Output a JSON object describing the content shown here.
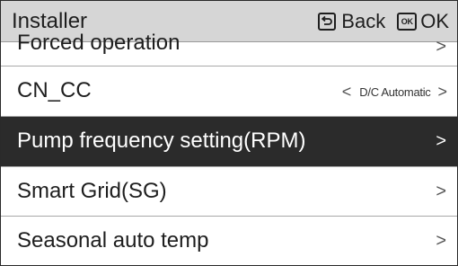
{
  "header": {
    "title": "Installer",
    "back_label": "Back",
    "ok_label": "OK",
    "ok_icon_text": "OK"
  },
  "menu": {
    "items": [
      {
        "label": "Forced operation",
        "chevron": ">"
      },
      {
        "label": "CN_CC",
        "value": "D/C Automatic",
        "left_arrow": "<",
        "right_arrow": ">"
      },
      {
        "label": "Pump frequency setting(RPM)",
        "chevron": ">",
        "selected": true
      },
      {
        "label": "Smart Grid(SG)",
        "chevron": ">"
      },
      {
        "label": "Seasonal auto temp",
        "chevron": ">"
      }
    ]
  },
  "colors": {
    "header_bg": "#d6d6d6",
    "selected_bg": "#2b2b2b",
    "text": "#1e1e1e",
    "divider": "#a8a8a8"
  },
  "icons": {
    "back": "back-key-icon",
    "ok": "ok-key-icon",
    "chevron": "chevron-right-icon"
  }
}
